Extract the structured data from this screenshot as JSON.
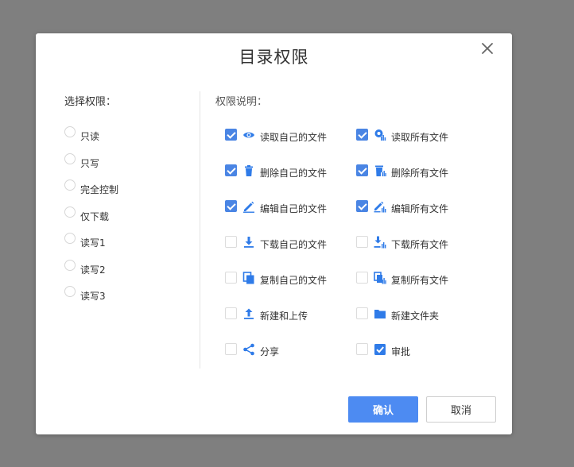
{
  "dialog": {
    "title": "目录权限",
    "close_icon": "close-icon"
  },
  "left": {
    "heading": "选择权限：",
    "options": [
      {
        "label": "只读",
        "selected": false
      },
      {
        "label": "只写",
        "selected": false
      },
      {
        "label": "完全控制",
        "selected": false
      },
      {
        "label": "仅下载",
        "selected": false
      },
      {
        "label": "读写1",
        "selected": false
      },
      {
        "label": "读写2",
        "selected": false
      },
      {
        "label": "读写3",
        "selected": false
      }
    ]
  },
  "right": {
    "heading": "权限说明：",
    "permissions": [
      {
        "label": "读取自己的文件",
        "checked": true,
        "icon": "eye-icon"
      },
      {
        "label": "读取所有文件",
        "checked": true,
        "icon": "read-all-icon"
      },
      {
        "label": "删除自己的文件",
        "checked": true,
        "icon": "trash-icon"
      },
      {
        "label": "删除所有文件",
        "checked": true,
        "icon": "delete-all-icon"
      },
      {
        "label": "编辑自己的文件",
        "checked": true,
        "icon": "pencil-icon"
      },
      {
        "label": "编辑所有文件",
        "checked": true,
        "icon": "edit-all-icon"
      },
      {
        "label": "下载自己的文件",
        "checked": false,
        "icon": "download-icon"
      },
      {
        "label": "下载所有文件",
        "checked": false,
        "icon": "download-all-icon"
      },
      {
        "label": "复制自己的文件",
        "checked": false,
        "icon": "copy-icon"
      },
      {
        "label": "复制所有文件",
        "checked": false,
        "icon": "copy-all-icon"
      },
      {
        "label": "新建和上传",
        "checked": false,
        "icon": "upload-icon"
      },
      {
        "label": "新建文件夹",
        "checked": false,
        "icon": "folder-icon"
      },
      {
        "label": "分享",
        "checked": false,
        "icon": "share-icon"
      },
      {
        "label": "审批",
        "checked": false,
        "icon": "approve-icon"
      }
    ]
  },
  "buttons": {
    "ok_label": "确认",
    "cancel_label": "取消"
  },
  "colors": {
    "accent": "#4d8bf2",
    "icon_blue": "#2f7be8",
    "overlay": "#7f7f7f"
  }
}
